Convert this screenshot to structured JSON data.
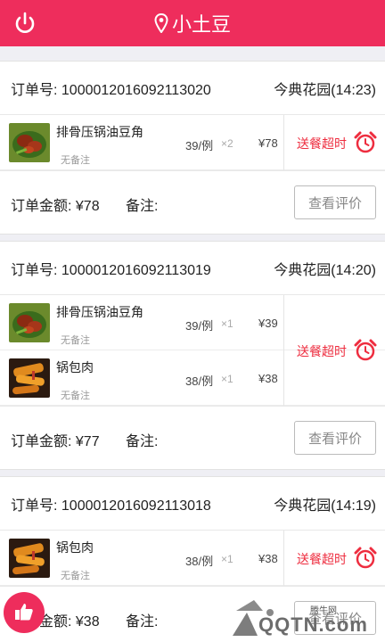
{
  "header": {
    "title": "小土豆",
    "bg_color": "#ee2d5c",
    "power_icon": "power-icon",
    "location_icon": "location-pin-icon"
  },
  "orders": [
    {
      "order_label": "订单号:",
      "order_no": "1000012016092113020",
      "location": "今典花园(14:23)",
      "items": [
        {
          "name": "排骨压锅油豆角",
          "note": "无备注",
          "price": "39/例",
          "qty": "×2",
          "subtotal": "¥78"
        }
      ],
      "status": "送餐超时",
      "total_label": "订单金额:",
      "total": "¥78",
      "remark_label": "备注:",
      "remark": "",
      "button": "查看评价"
    },
    {
      "order_label": "订单号:",
      "order_no": "1000012016092113019",
      "location": "今典花园(14:20)",
      "items": [
        {
          "name": "排骨压锅油豆角",
          "note": "无备注",
          "price": "39/例",
          "qty": "×1",
          "subtotal": "¥39"
        },
        {
          "name": "锅包肉",
          "note": "无备注",
          "price": "38/例",
          "qty": "×1",
          "subtotal": "¥38"
        }
      ],
      "status": "送餐超时",
      "total_label": "订单金额:",
      "total": "¥77",
      "remark_label": "备注:",
      "remark": "",
      "button": "查看评价"
    },
    {
      "order_label": "订单号:",
      "order_no": "1000012016092113018",
      "location": "今典花园(14:19)",
      "items": [
        {
          "name": "锅包肉",
          "note": "无备注",
          "price": "38/例",
          "qty": "×1",
          "subtotal": "¥38"
        }
      ],
      "status": "送餐超时",
      "total_label": "订单金额:",
      "total": "¥38",
      "remark_label": "备注:",
      "remark": "",
      "button": "查看评价"
    }
  ],
  "status_color": "#ee2d3f",
  "watermark": {
    "small": "腾牛网",
    "big": "QQTN.com"
  }
}
